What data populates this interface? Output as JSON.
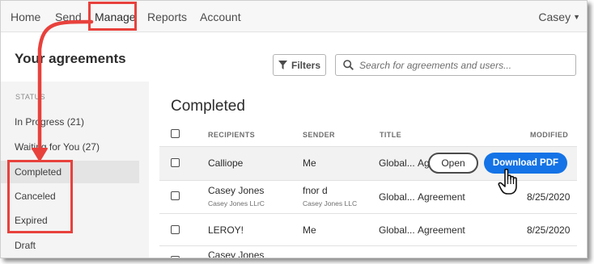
{
  "nav": {
    "items": [
      {
        "label": "Home"
      },
      {
        "label": "Send"
      },
      {
        "label": "Manage"
      },
      {
        "label": "Reports"
      },
      {
        "label": "Account"
      }
    ],
    "user": "Casey"
  },
  "header": {
    "title": "Your agreements",
    "filters_label": "Filters",
    "search_placeholder": "Search for agreements and users..."
  },
  "sidebar": {
    "heading": "STATUS",
    "items": [
      {
        "label": "In Progress (21)"
      },
      {
        "label": "Waiting for You (27)"
      },
      {
        "label": "Completed"
      },
      {
        "label": "Canceled"
      },
      {
        "label": "Expired"
      },
      {
        "label": "Draft"
      }
    ]
  },
  "main": {
    "section_title": "Completed",
    "columns": {
      "recipients": "RECIPIENTS",
      "sender": "SENDER",
      "title": "TITLE",
      "modified": "MODIFIED"
    },
    "rows": [
      {
        "recipient": "Calliope",
        "recipient_sub": "",
        "sender": "Me",
        "sender_sub": "",
        "title_prefix": "Global...",
        "title": "Ag",
        "modified": ""
      },
      {
        "recipient": "Casey Jones",
        "recipient_sub": "Casey Jones LLrC",
        "sender": "fnor d",
        "sender_sub": "Casey Jones LLC",
        "title_prefix": "Global...",
        "title": "Agreement",
        "modified": "8/25/2020"
      },
      {
        "recipient": "LEROY!",
        "recipient_sub": "",
        "sender": "Me",
        "sender_sub": "",
        "title_prefix": "Global...",
        "title": "Agreement",
        "modified": "8/25/2020"
      },
      {
        "recipient": "Casey Jones",
        "recipient_sub": "",
        "sender": "",
        "sender_sub": "",
        "title_prefix": "",
        "title": "",
        "modified": ""
      }
    ],
    "open_label": "Open",
    "download_label": "Download PDF"
  },
  "colors": {
    "accent_blue": "#1473e6",
    "annotation_red": "#e8413c"
  },
  "icons": [
    "funnel-icon",
    "search-icon",
    "chevron-down-icon",
    "hand-cursor-icon"
  ]
}
